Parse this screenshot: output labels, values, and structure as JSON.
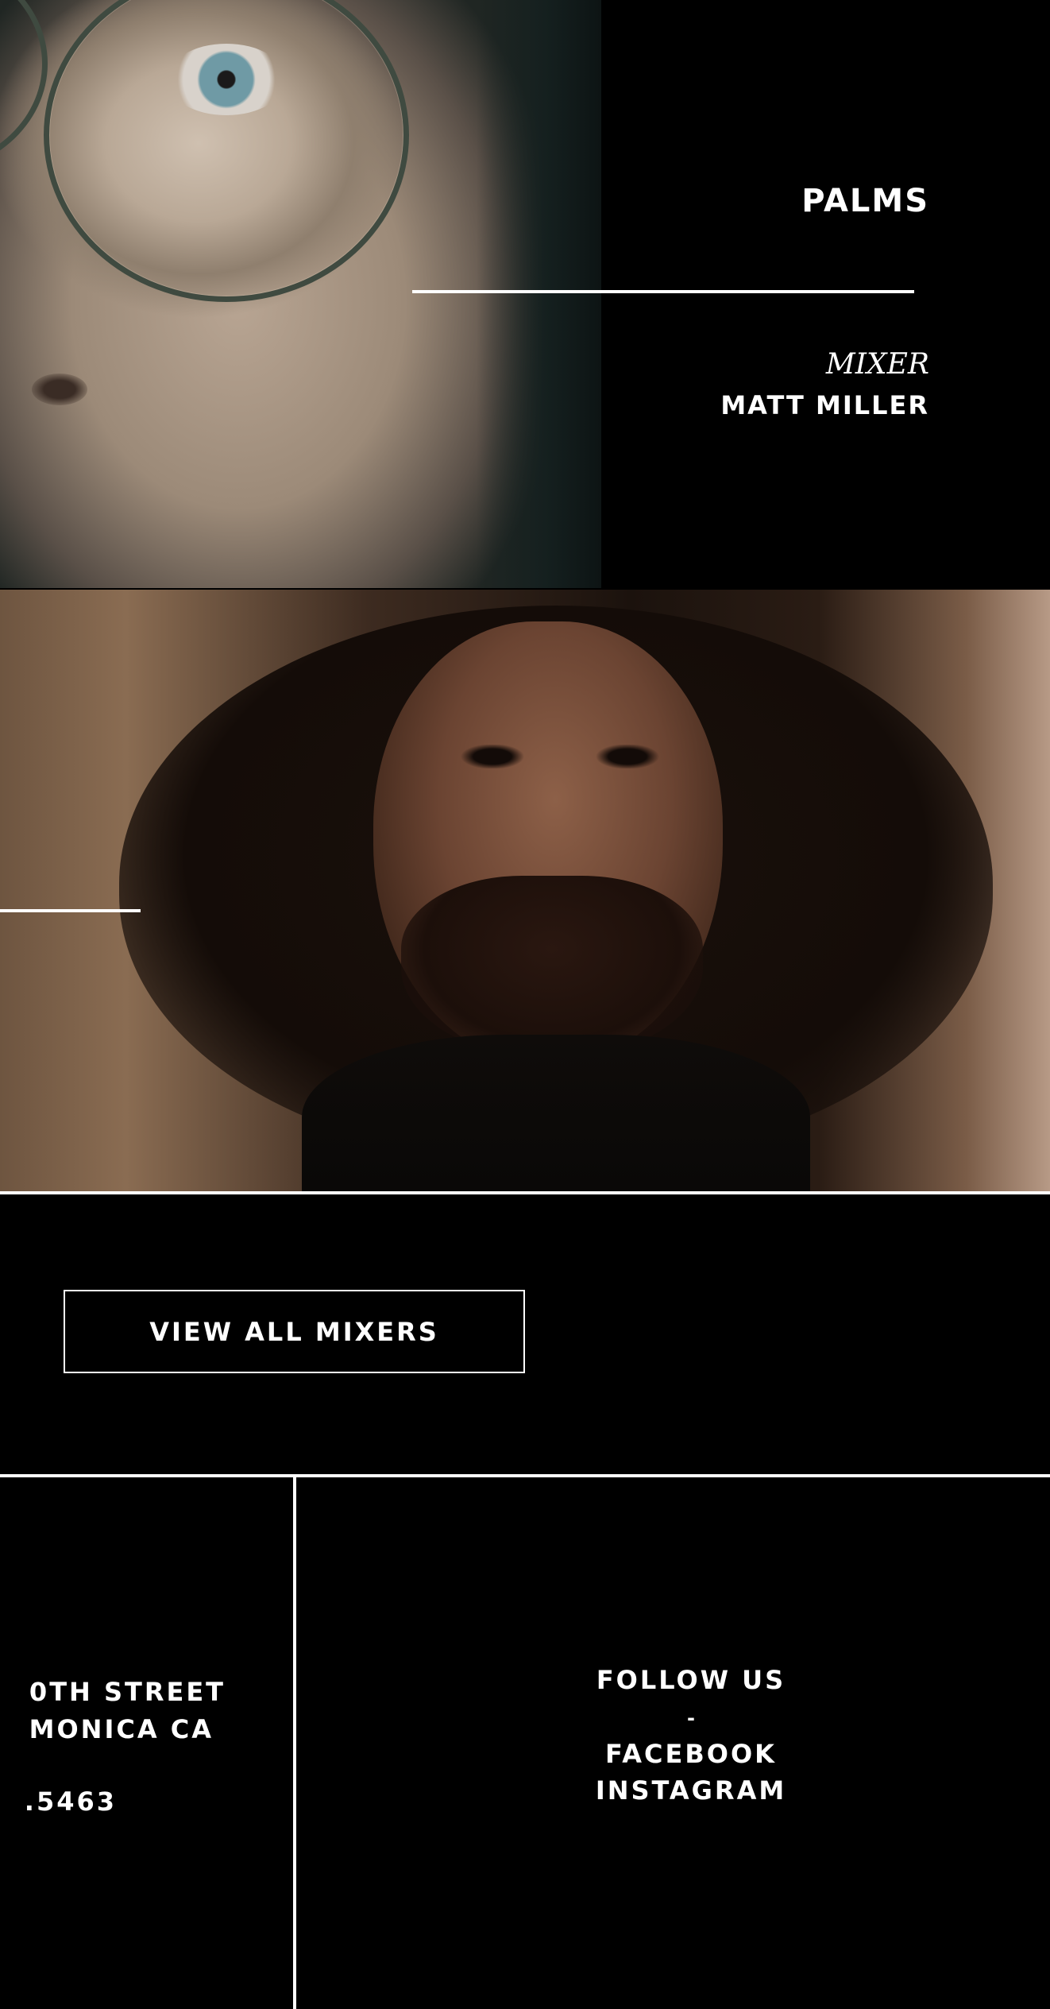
{
  "projects": [
    {
      "title": "PALMS",
      "role": "MIXER",
      "name": "MATT MILLER"
    },
    {
      "title": "",
      "role": "",
      "name": ""
    }
  ],
  "view_all": {
    "label": "VIEW ALL MIXERS"
  },
  "footer": {
    "address_line_1": "0TH STREET",
    "address_line_2": "MONICA CA",
    "phone": ".5463",
    "follow_heading": "FOLLOW US",
    "follow_separator": "-",
    "facebook_label": "FACEBOOK",
    "instagram_label": "INSTAGRAM"
  },
  "colors": {
    "background": "#000000",
    "text": "#ffffff",
    "rule": "#ffffff"
  }
}
